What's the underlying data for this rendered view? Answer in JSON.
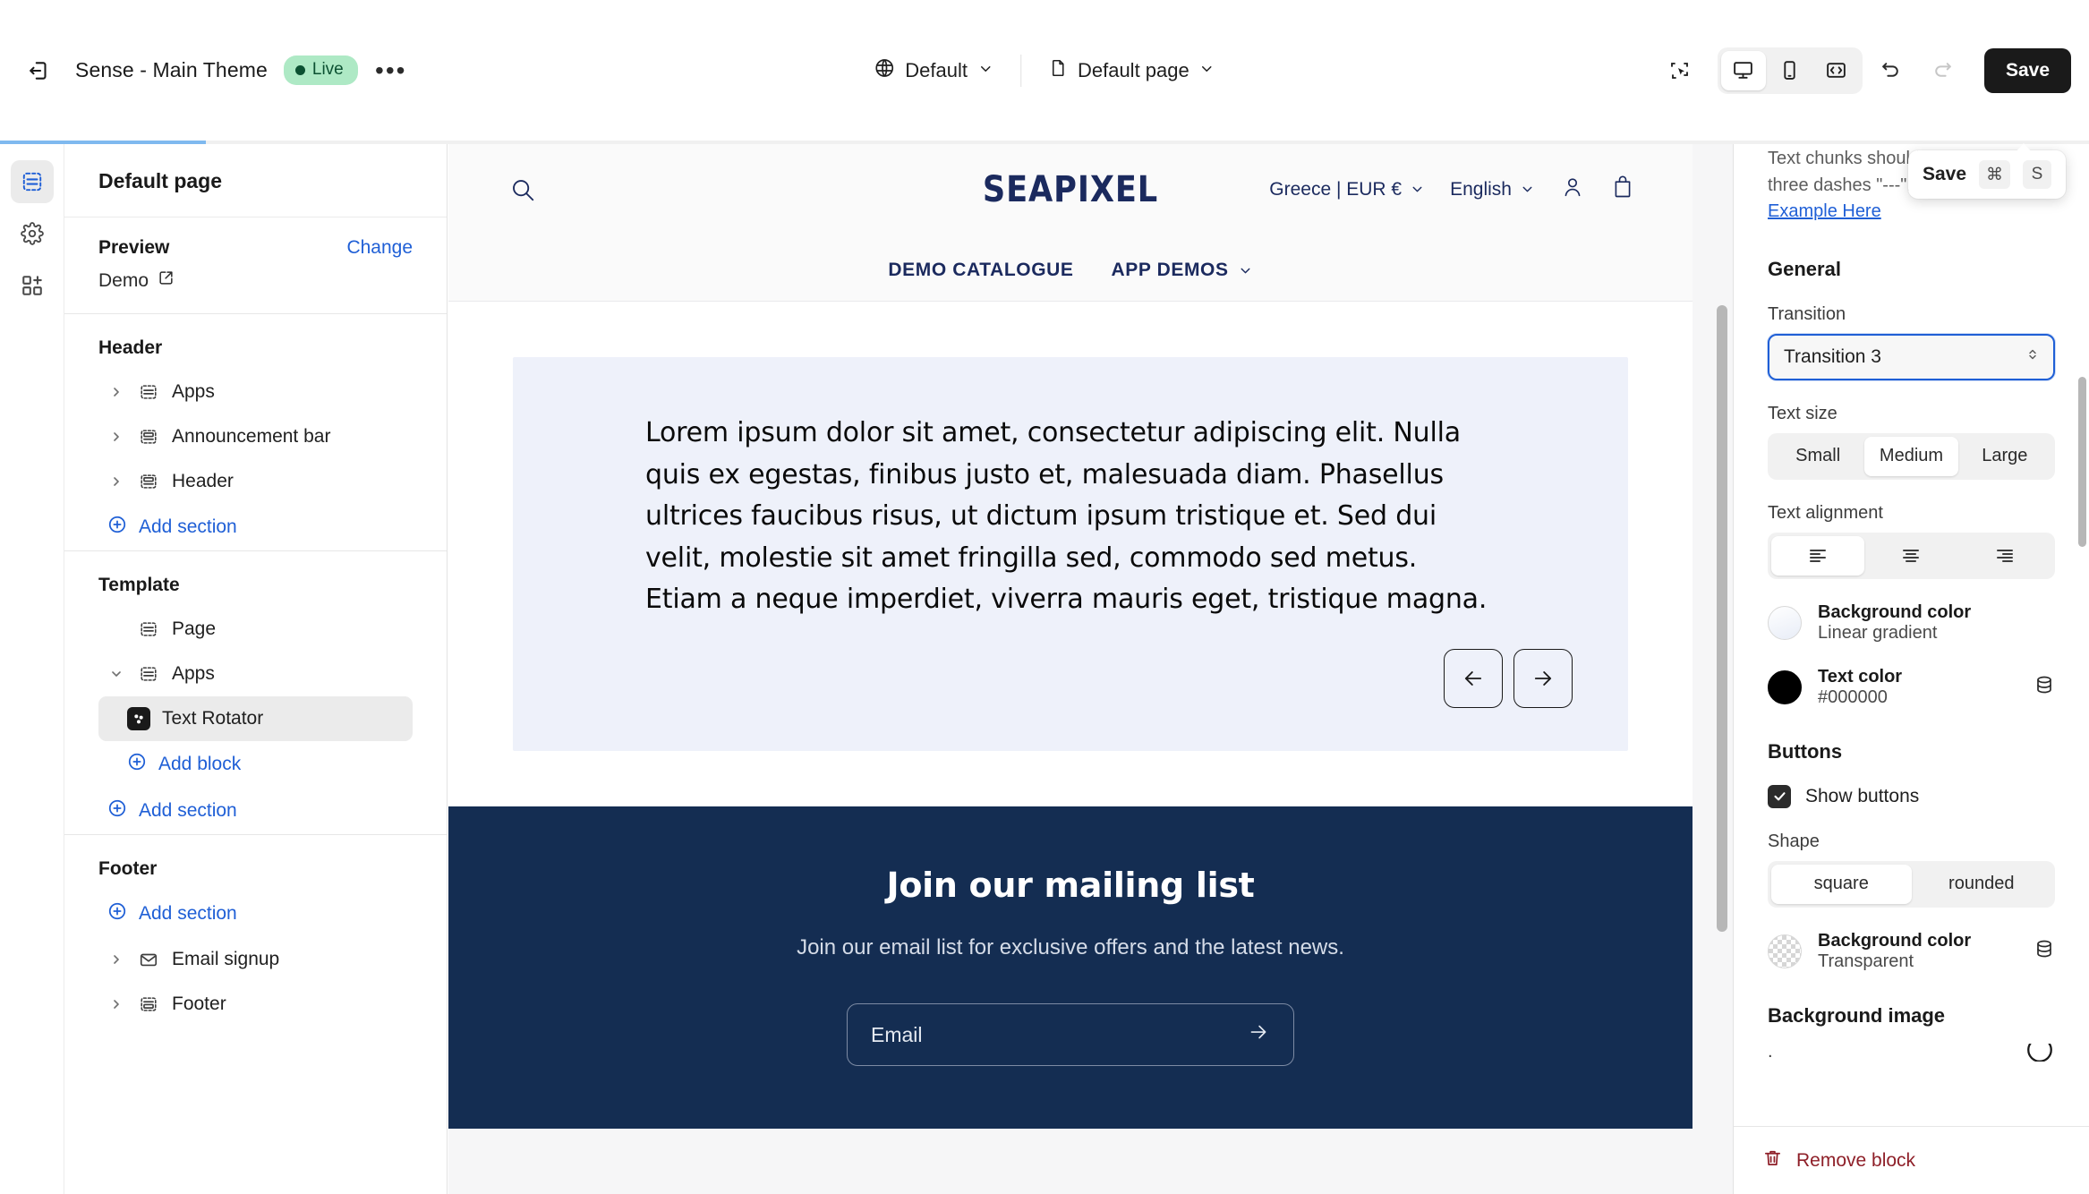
{
  "topbar": {
    "exit_icon": "exit-icon",
    "theme_title": "Sense - Main Theme",
    "live_label": "Live",
    "more_label": "•••",
    "locale_select": "Default",
    "page_select": "Default page",
    "devices": [
      "desktop",
      "mobile",
      "fullscreen"
    ],
    "save_label": "Save",
    "tooltip": {
      "label": "Save",
      "key_mod": "⌘",
      "key_char": "S"
    }
  },
  "rail": {
    "items": [
      {
        "name": "sections",
        "active": true
      },
      {
        "name": "theme-settings",
        "active": false
      },
      {
        "name": "apps",
        "active": false
      }
    ]
  },
  "sidebar": {
    "title": "Default page",
    "preview": {
      "label": "Preview",
      "change_label": "Change",
      "value": "Demo"
    },
    "groups": [
      {
        "title": "Header",
        "items": [
          {
            "label": "Apps",
            "icon": "section-icon",
            "caret": "right",
            "type": "section"
          },
          {
            "label": "Announcement bar",
            "icon": "section-icon",
            "caret": "right",
            "type": "section"
          },
          {
            "label": "Header",
            "icon": "section-icon",
            "caret": "right",
            "type": "section"
          }
        ],
        "add_label": "Add section"
      },
      {
        "title": "Template",
        "items": [
          {
            "label": "Page",
            "icon": "section-icon",
            "caret": "none",
            "type": "section"
          },
          {
            "label": "Apps",
            "icon": "section-icon",
            "caret": "down",
            "type": "section"
          },
          {
            "label": "Text Rotator",
            "icon": "app-icon",
            "caret": "none",
            "type": "block",
            "selected": true
          },
          {
            "label": "Add block",
            "type": "add-block"
          }
        ],
        "add_label": "Add section"
      },
      {
        "title": "Footer",
        "add_label": "Add section",
        "items_after": [
          {
            "label": "Email signup",
            "icon": "envelope-icon",
            "caret": "right",
            "type": "section"
          },
          {
            "label": "Footer",
            "icon": "section-icon",
            "caret": "right",
            "type": "section"
          }
        ]
      }
    ]
  },
  "preview": {
    "store": {
      "logo": "SEAPIXEL",
      "search_icon": "search-icon",
      "country_currency": "Greece | EUR €",
      "language": "English",
      "account_icon": "person-icon",
      "cart_icon": "cart-icon",
      "nav": [
        {
          "label": "DEMO CATALOGUE",
          "has_caret": false
        },
        {
          "label": "APP DEMOS",
          "has_caret": true
        }
      ]
    },
    "rotator": {
      "text": "Lorem ipsum dolor sit amet, consectetur adipiscing elit. Nulla quis ex egestas, finibus justo et, malesuada diam. Phasellus ultrices faucibus risus, ut dictum ipsum tristique et. Sed dui velit, molestie sit amet fringilla sed, commodo sed metus. Etiam a neque imperdiet, viverra mauris eget, tristique magna.",
      "prev_icon": "arrow-left-icon",
      "next_icon": "arrow-right-icon"
    },
    "mailing": {
      "heading": "Join our mailing list",
      "subtext": "Join our email list for exclusive offers and the latest news.",
      "input_placeholder": "Email",
      "submit_icon": "arrow-right-icon"
    }
  },
  "settings": {
    "help_text_1": "Text chunks should be separ",
    "help_text_2": "three dashes \"---\". You can find an",
    "help_link": "Example Here",
    "general_heading": "General",
    "transition": {
      "label": "Transition",
      "value": "Transition 3"
    },
    "text_size": {
      "label": "Text size",
      "options": [
        "Small",
        "Medium",
        "Large"
      ],
      "selected": "Medium"
    },
    "text_alignment": {
      "label": "Text alignment",
      "options": [
        "left",
        "center",
        "right"
      ],
      "selected": "left"
    },
    "background_color": {
      "name": "Background color",
      "value": "Linear gradient"
    },
    "text_color": {
      "name": "Text color",
      "value": "#000000"
    },
    "buttons_heading": "Buttons",
    "show_buttons": {
      "label": "Show buttons",
      "checked": true
    },
    "shape": {
      "label": "Shape",
      "options": [
        "square",
        "rounded"
      ],
      "selected": "square"
    },
    "button_bg_color": {
      "name": "Background color",
      "value": "Transparent"
    },
    "background_image_heading": "Background image",
    "remove_block_label": "Remove block"
  },
  "colors": {
    "accent_blue": "#1f5fd6",
    "live_green_bg": "#aee9c5",
    "live_green_fg": "#0c5132",
    "footer_navy": "#142d52",
    "rotator_bg": "#eef1fa",
    "store_brand": "#1b2a5e",
    "danger": "#8e1f28"
  }
}
